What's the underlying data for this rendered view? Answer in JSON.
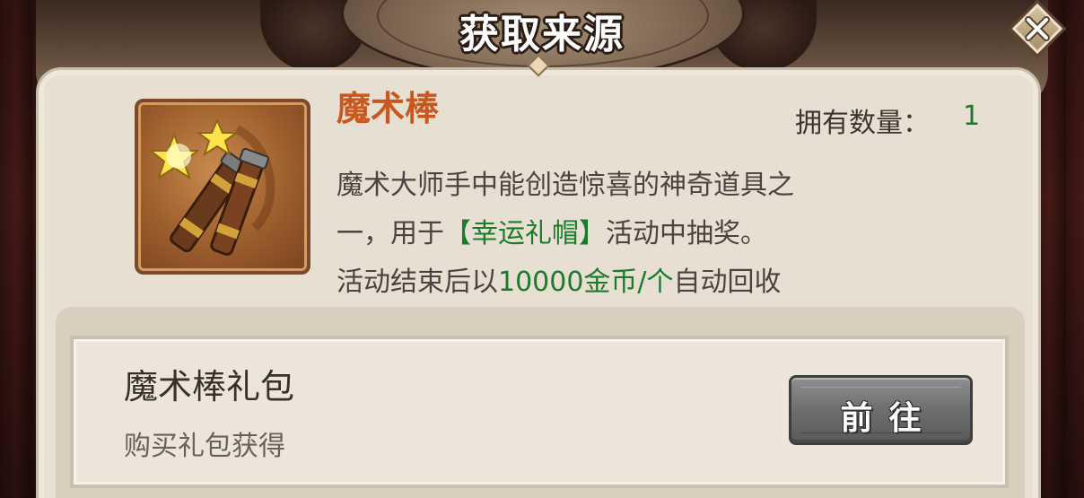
{
  "dialog": {
    "title": "获取来源"
  },
  "item": {
    "name": "魔术棒",
    "owned_label": "拥有数量：",
    "owned_count": "1",
    "desc": {
      "line1": "魔术大师手中能创造惊喜的神奇道具之",
      "line2_a": "一，用于",
      "line2_highlight": "【幸运礼帽】",
      "line2_b": "活动中抽奖。",
      "line3_a": "活动结束后以",
      "line3_highlight": "10000金币/个",
      "line3_b": "自动回收"
    },
    "icon": "magic-wand-icon"
  },
  "source": {
    "title": "魔术棒礼包",
    "subtitle": "购买礼包获得",
    "button_label": "前往"
  },
  "colors": {
    "item_name": "#c9581e",
    "highlight": "#1d7a2a",
    "panel": "#e6dfd2",
    "button": "#6e6e6e"
  }
}
